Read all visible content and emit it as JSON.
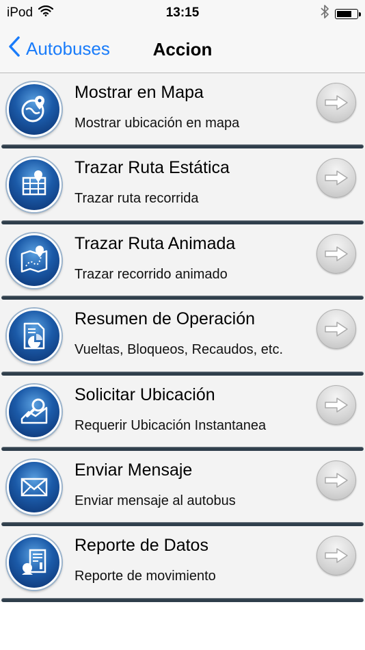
{
  "status_bar": {
    "carrier": "iPod",
    "time": "13:15",
    "battery_level": 0.75
  },
  "nav": {
    "back_label": "Autobuses",
    "title": "Accion"
  },
  "actions": [
    {
      "title": "Mostrar en Mapa",
      "subtitle": "Mostrar ubicación en mapa",
      "icon": "map-location-icon"
    },
    {
      "title": "Trazar Ruta Estática",
      "subtitle": "Trazar ruta recorrida",
      "icon": "route-grid-icon"
    },
    {
      "title": "Trazar Ruta Animada",
      "subtitle": "Trazar recorrido animado",
      "icon": "animated-route-icon"
    },
    {
      "title": "Resumen de Operación",
      "subtitle": "Vueltas, Bloqueos, Recaudos, etc.",
      "icon": "report-chart-icon"
    },
    {
      "title": "Solicitar Ubicación",
      "subtitle": "Requerir Ubicación Instantanea",
      "icon": "request-location-icon"
    },
    {
      "title": "Enviar Mensaje",
      "subtitle": "Enviar mensaje al autobus",
      "icon": "envelope-icon"
    },
    {
      "title": "Reporte de Datos",
      "subtitle": "Reporte de movimiento",
      "icon": "data-report-icon"
    }
  ]
}
